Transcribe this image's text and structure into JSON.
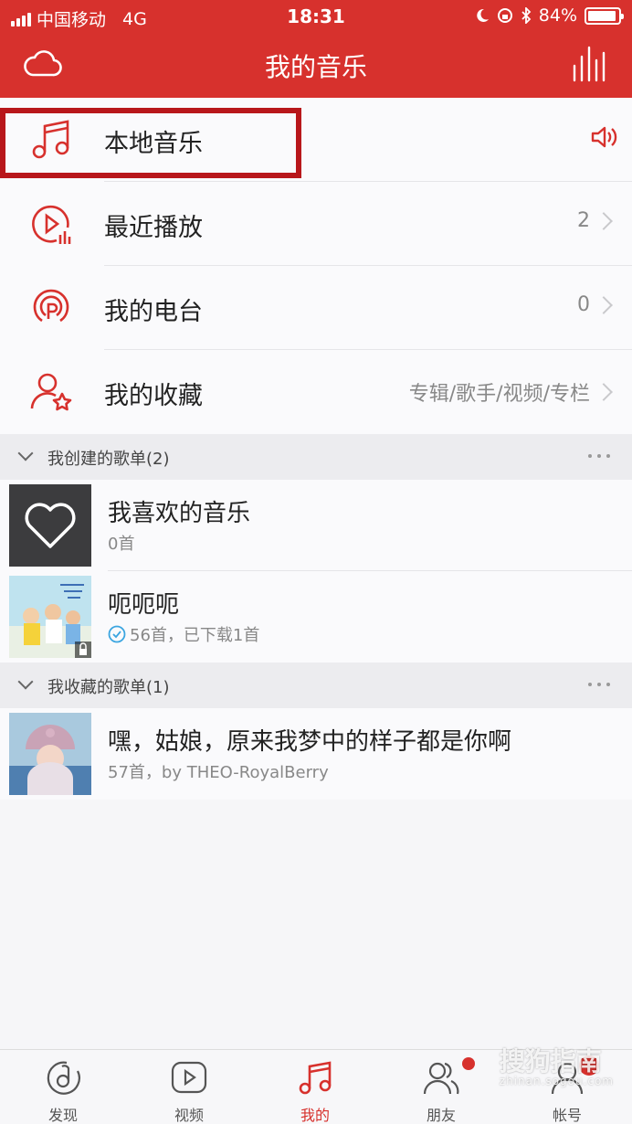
{
  "status_bar": {
    "carrier": "中国移动",
    "network": "4G",
    "time": "18:31",
    "battery": "84%"
  },
  "header": {
    "title": "我的音乐",
    "background": "#d7312d"
  },
  "menu": {
    "local_music": {
      "label": "本地音乐",
      "icon": "music-note-icon"
    },
    "recent": {
      "label": "最近播放",
      "count": "2",
      "icon": "recent-play-icon"
    },
    "radio": {
      "label": "我的电台",
      "count": "0",
      "icon": "radio-icon"
    },
    "favorites": {
      "label": "我的收藏",
      "hint": "专辑/歌手/视频/专栏",
      "icon": "user-star-icon"
    }
  },
  "created_section": {
    "title": "我创建的歌单(2)"
  },
  "created_playlists": [
    {
      "name": "我喜欢的音乐",
      "info": "0首"
    },
    {
      "name": "呃呃呃",
      "info": "56首，已下载1首"
    }
  ],
  "collected_section": {
    "title": "我收藏的歌单(1)"
  },
  "collected_playlists": [
    {
      "name": "嘿，姑娘，原来我梦中的样子都是你啊",
      "info": "57首，by THEO-RoyalBerry"
    }
  ],
  "tabs": [
    {
      "label": "发现",
      "icon": "discover-icon"
    },
    {
      "label": "视频",
      "icon": "video-play-icon"
    },
    {
      "label": "我的",
      "icon": "music-note-icon",
      "active": true
    },
    {
      "label": "朋友",
      "icon": "friends-icon"
    },
    {
      "label": "帐号",
      "icon": "account-icon"
    }
  ],
  "watermark": {
    "text": "搜狗指南",
    "url": "zhinan.sogou.com"
  },
  "colors": {
    "accent": "#d7312d",
    "highlight_box": "#b8171b"
  }
}
